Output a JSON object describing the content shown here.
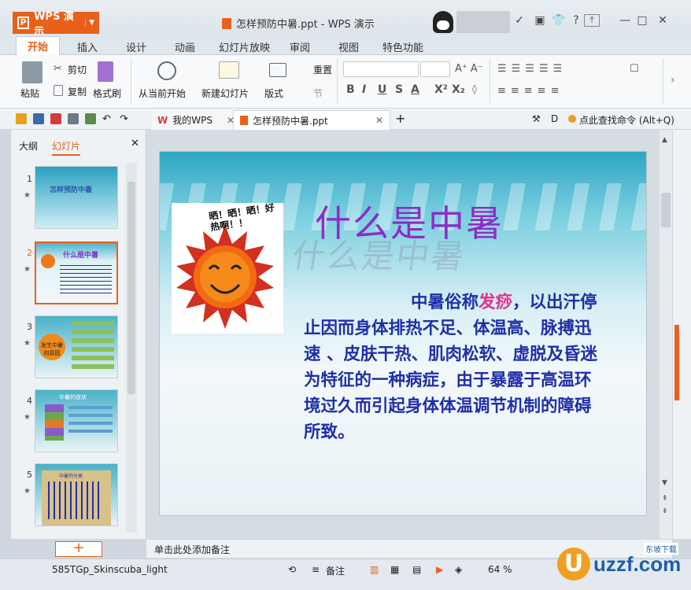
{
  "app": {
    "name": "WPS 演示",
    "window_title": "怎样预防中暑.ppt - WPS 演示"
  },
  "tabs": [
    "开始",
    "插入",
    "设计",
    "动画",
    "幻灯片放映",
    "审阅",
    "视图",
    "特色功能"
  ],
  "ribbon": {
    "paste": "粘贴",
    "cut": "剪切",
    "copy": "复制",
    "format_painter": "格式刷",
    "from_current": "从当前开始",
    "new_slide": "新建幻灯片",
    "layout": "版式",
    "reset": "重置",
    "section": "节"
  },
  "doc_tabs": {
    "my_wps": "我的WPS",
    "file": "怎样预防中暑.ppt",
    "find_command": "点此查找命令 (Alt+Q)"
  },
  "left_pane": {
    "outline_tab": "大纲",
    "slides_tab": "幻灯片",
    "slides": [
      {
        "num": "1",
        "thumb_title": "怎样预防中暑"
      },
      {
        "num": "2",
        "thumb_title": "什么是中暑"
      },
      {
        "num": "3",
        "thumb_title": "发生中暑的原因"
      },
      {
        "num": "4",
        "thumb_title": "中暑的症状"
      },
      {
        "num": "5",
        "thumb_title": "中暑的分类"
      }
    ],
    "add_button": "+"
  },
  "slide": {
    "image_caption": "晒！晒！晒！好热啊！！",
    "title": "什么是中暑",
    "body_pre": "中暑俗称",
    "body_highlight": "发痧",
    "body_post": "，以出汗停止因而身体排热不足、体温高、脉搏迅速 、皮肤干热、肌肉松软、虚脱及昏迷为特征的一种病症，由于暴露于高温环境过久而引起身体体温调节机制的障碍所致。"
  },
  "notes_placeholder": "单击此处添加备注",
  "status": {
    "theme": "585TGp_Skinscuba_light",
    "notes": "备注",
    "zoom": "64 %"
  },
  "watermark": {
    "site": "uzzf.com",
    "cn": "东坡下载"
  },
  "colors": {
    "accent": "#e8611a",
    "body_text": "#1f2fa8",
    "title": "#8a2ec8",
    "highlight": "#e0308a"
  }
}
